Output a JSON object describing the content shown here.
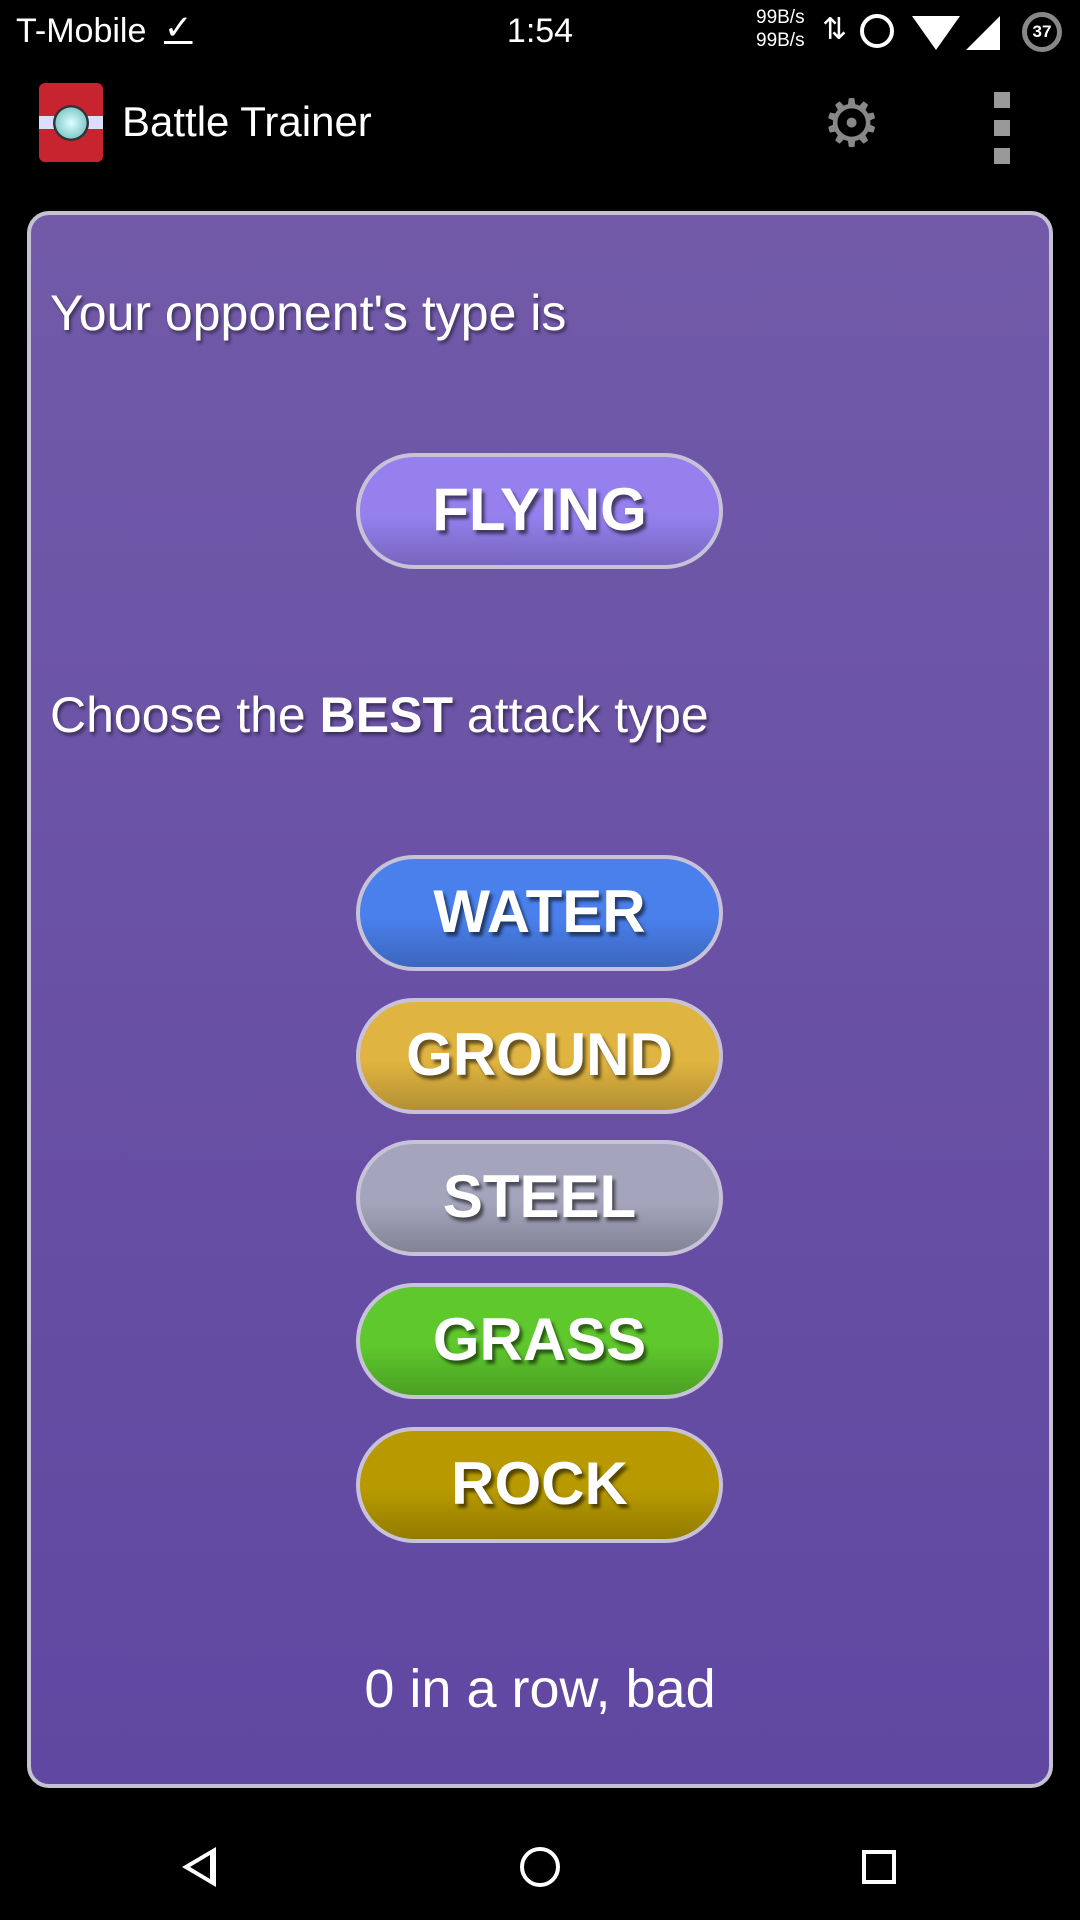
{
  "status_bar": {
    "carrier": "T-Mobile",
    "time": "1:54",
    "net_up": "99B/s",
    "net_down": "99B/s",
    "battery": "37"
  },
  "app_bar": {
    "title": "Battle Trainer",
    "settings_icon": "gear-icon",
    "menu_icon": "overflow-menu-icon"
  },
  "quiz": {
    "opponent_prompt": "Your opponent's type is",
    "opponent_type": {
      "label": "FLYING",
      "color": "#9580ee"
    },
    "choose_prefix": "Choose the ",
    "choose_bold": "BEST",
    "choose_suffix": " attack type",
    "options": [
      {
        "label": "WATER",
        "color": "#4a80ec"
      },
      {
        "label": "GROUND",
        "color": "#e0b440"
      },
      {
        "label": "STEEL",
        "color": "#a4a4bc"
      },
      {
        "label": "GRASS",
        "color": "#5ec82c"
      },
      {
        "label": "ROCK",
        "color": "#b89a00"
      }
    ],
    "streak": "0 in a row, bad"
  }
}
